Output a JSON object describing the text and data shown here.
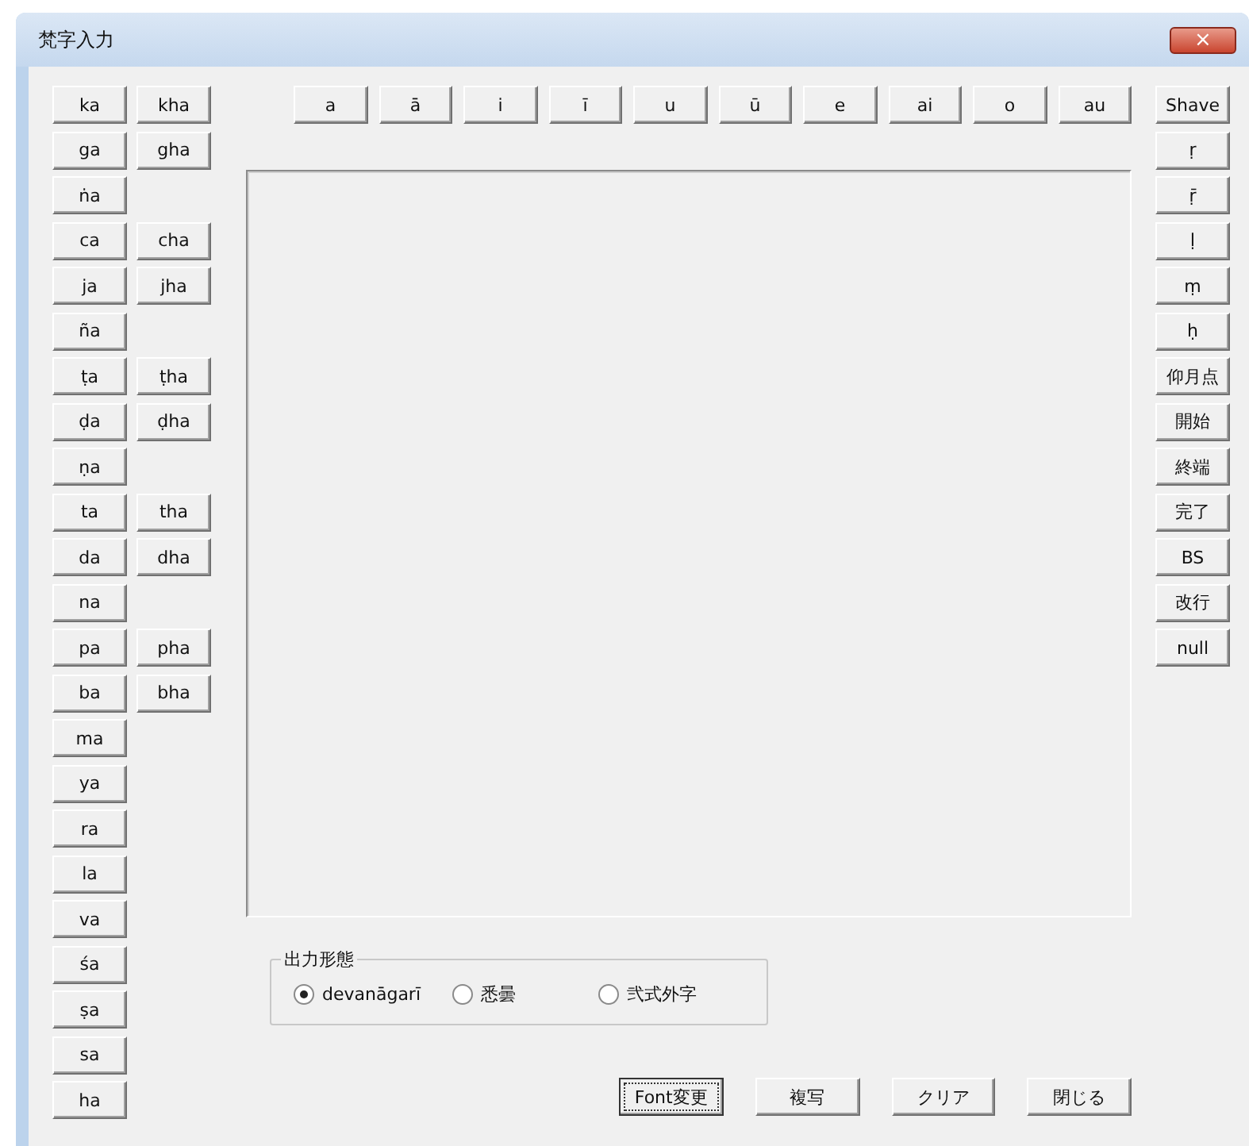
{
  "window": {
    "title": "梵字入力",
    "close": "×"
  },
  "consonant_rows": [
    [
      "ka",
      "kha"
    ],
    [
      "ga",
      "gha"
    ],
    [
      "ṅa"
    ],
    [
      "ca",
      "cha"
    ],
    [
      "ja",
      "jha"
    ],
    [
      "ña"
    ],
    [
      "ṭa",
      "ṭha"
    ],
    [
      "ḍa",
      "ḍha"
    ],
    [
      "ṇa"
    ],
    [
      "ta",
      "tha"
    ],
    [
      "da",
      "dha"
    ],
    [
      "na"
    ],
    [
      "pa",
      "pha"
    ],
    [
      "ba",
      "bha"
    ],
    [
      "ma"
    ],
    [
      "ya"
    ],
    [
      "ra"
    ],
    [
      "la"
    ],
    [
      "va"
    ],
    [
      "śa"
    ],
    [
      "ṣa"
    ],
    [
      "sa"
    ],
    [
      "ha"
    ]
  ],
  "vowels": [
    "a",
    "ā",
    "i",
    "ī",
    "u",
    "ū",
    "e",
    "ai",
    "o",
    "au"
  ],
  "side_buttons": [
    "Shave",
    "ṛ",
    "ṝ",
    "ḷ",
    "ṃ",
    "ḥ",
    "仰月点",
    "開始",
    "終端",
    "完了",
    "BS",
    "改行",
    "null"
  ],
  "output_format": {
    "label": "出力形態",
    "options": [
      {
        "label": "devanāgarī",
        "selected": true
      },
      {
        "label": "悉曇",
        "selected": false
      },
      {
        "label": "弐式外字",
        "selected": false
      }
    ]
  },
  "buttons": [
    {
      "label": "Font変更",
      "focused": true
    },
    {
      "label": "複写",
      "focused": false
    },
    {
      "label": "クリア",
      "focused": false
    },
    {
      "label": "閉じる",
      "focused": false
    }
  ]
}
